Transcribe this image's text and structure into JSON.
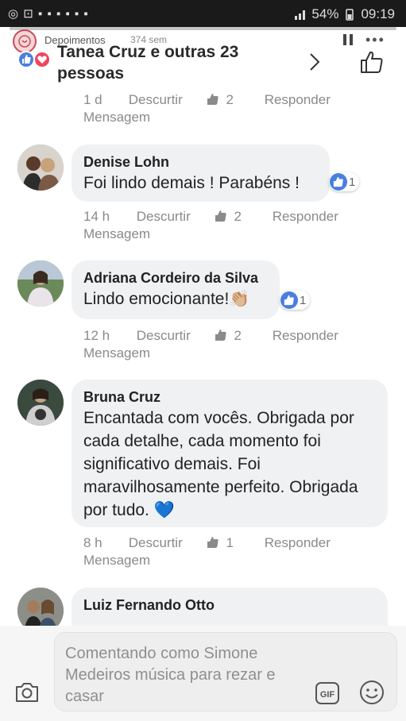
{
  "status_bar": {
    "battery": "54%",
    "time": "09:19"
  },
  "story": {
    "name": "Depoimentos",
    "views": "374 sem"
  },
  "reactions": {
    "summary": "Tanea Cruz e outras 23 pessoas"
  },
  "first_meta": {
    "time": "1 d",
    "delete": "Descurtir",
    "likes": "2",
    "reply": "Responder",
    "message": "Mensagem"
  },
  "comments": [
    {
      "name": "Denise Lohn",
      "text": "Foi lindo demais ! Parabéns !",
      "like_count": "1",
      "time": "14 h",
      "delete": "Descurtir",
      "likes": "2",
      "reply": "Responder",
      "message": "Mensagem"
    },
    {
      "name": "Adriana Cordeiro da Silva",
      "text": "Lindo emocionante!👏🏼",
      "like_count": "1",
      "time": "12 h",
      "delete": "Descurtir",
      "likes": "2",
      "reply": "Responder",
      "message": "Mensagem"
    },
    {
      "name": "Bruna Cruz",
      "text": "Encantada com vocês. Obrigada por cada detalhe, cada momento foi significativo demais. Foi maravilhosamente perfeito. Obrigada por tudo. 💙",
      "time": "8 h",
      "delete": "Descurtir",
      "likes": "1",
      "reply": "Responder",
      "message": "Mensagem"
    },
    {
      "name": "Luiz Fernando Otto"
    }
  ],
  "composer": {
    "placeholder": "Comentando como Simone Medeiros música para rezar e casar"
  },
  "colors": {
    "like_blue": "#4a7fe0",
    "love_red": "#f0455e",
    "bubble": "#f0f1f3",
    "meta_gray": "#8a8a8a"
  },
  "icons": [
    "story-avatar-icon",
    "like-reaction-icon",
    "love-reaction-icon",
    "chevron-right-icon",
    "thumbs-up-outline-icon",
    "like-small-icon",
    "camera-icon",
    "gif-icon",
    "smile-icon",
    "pause-icon",
    "more-icon"
  ]
}
